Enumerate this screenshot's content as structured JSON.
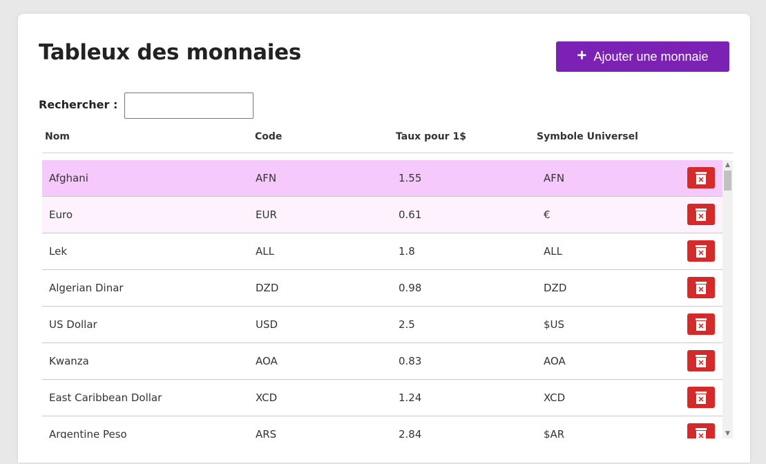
{
  "page": {
    "title": "Tableux des monnaies",
    "add_button_label": "Ajouter une monnaie",
    "search_label": "Rechercher :",
    "search_value": ""
  },
  "table": {
    "headers": [
      "Nom",
      "Code",
      "Taux pour 1$",
      "Symbole Universel"
    ],
    "rows": [
      {
        "name": "Afghani",
        "code": "AFN",
        "rate": "1.55",
        "symbol": "AFN",
        "highlight": "#f5c9fb"
      },
      {
        "name": "Euro",
        "code": "EUR",
        "rate": "0.61",
        "symbol": "€",
        "highlight": "#fdf2fe"
      },
      {
        "name": "Lek",
        "code": "ALL",
        "rate": "1.8",
        "symbol": "ALL",
        "highlight": ""
      },
      {
        "name": "Algerian Dinar",
        "code": "DZD",
        "rate": "0.98",
        "symbol": "DZD",
        "highlight": ""
      },
      {
        "name": "US Dollar",
        "code": "USD",
        "rate": "2.5",
        "symbol": "$US",
        "highlight": ""
      },
      {
        "name": "Kwanza",
        "code": "AOA",
        "rate": "0.83",
        "symbol": "AOA",
        "highlight": ""
      },
      {
        "name": "East Caribbean Dollar",
        "code": "XCD",
        "rate": "1.24",
        "symbol": "XCD",
        "highlight": ""
      },
      {
        "name": "Argentine Peso",
        "code": "ARS",
        "rate": "2.84",
        "symbol": "$AR",
        "highlight": ""
      }
    ]
  },
  "colors": {
    "accent": "#7b22b4",
    "delete": "#d42a2a",
    "row_selected": "#f5c9fb",
    "row_hover": "#fdf2fe"
  },
  "icons": {
    "add": "plus-icon",
    "delete": "trash-icon"
  }
}
